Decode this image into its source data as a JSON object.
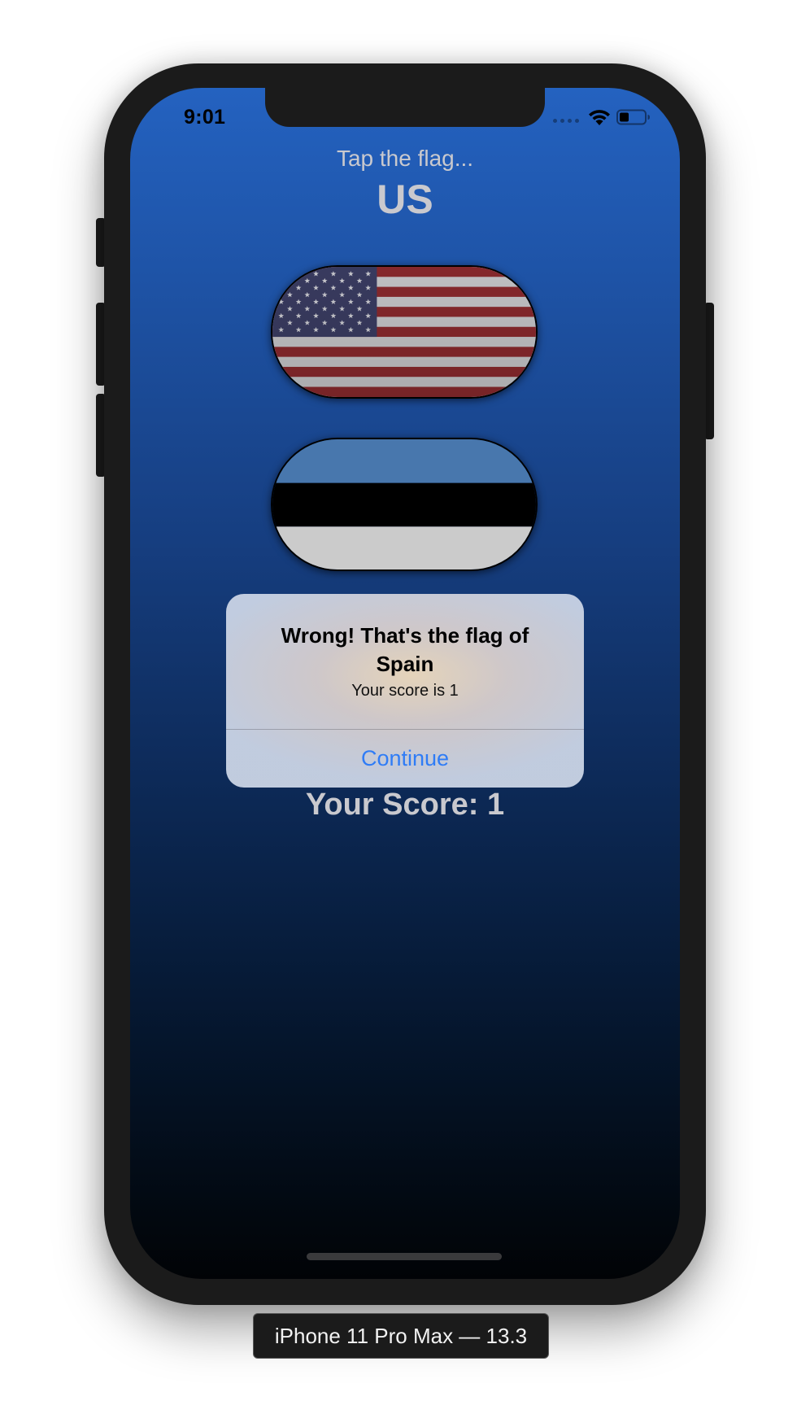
{
  "status_bar": {
    "time": "9:01",
    "icons": [
      "cellular-signal-icon",
      "wifi-icon",
      "battery-icon"
    ]
  },
  "game": {
    "prompt": "Tap the flag...",
    "target_country": "US",
    "flags": [
      {
        "country": "US",
        "icon": "us-flag-icon"
      },
      {
        "country": "Estonia",
        "icon": "estonia-flag-icon"
      }
    ],
    "score_label": "Your Score: 1"
  },
  "alert": {
    "title": "Wrong! That's the flag of Spain",
    "message": "Your score is 1",
    "button_label": "Continue"
  },
  "device_label": "iPhone 11 Pro Max — 13.3",
  "colors": {
    "background_top": "#2462c0",
    "background_bottom": "#010306",
    "alert_button": "#2f7cf6",
    "text_light": "#c9c9ce"
  }
}
